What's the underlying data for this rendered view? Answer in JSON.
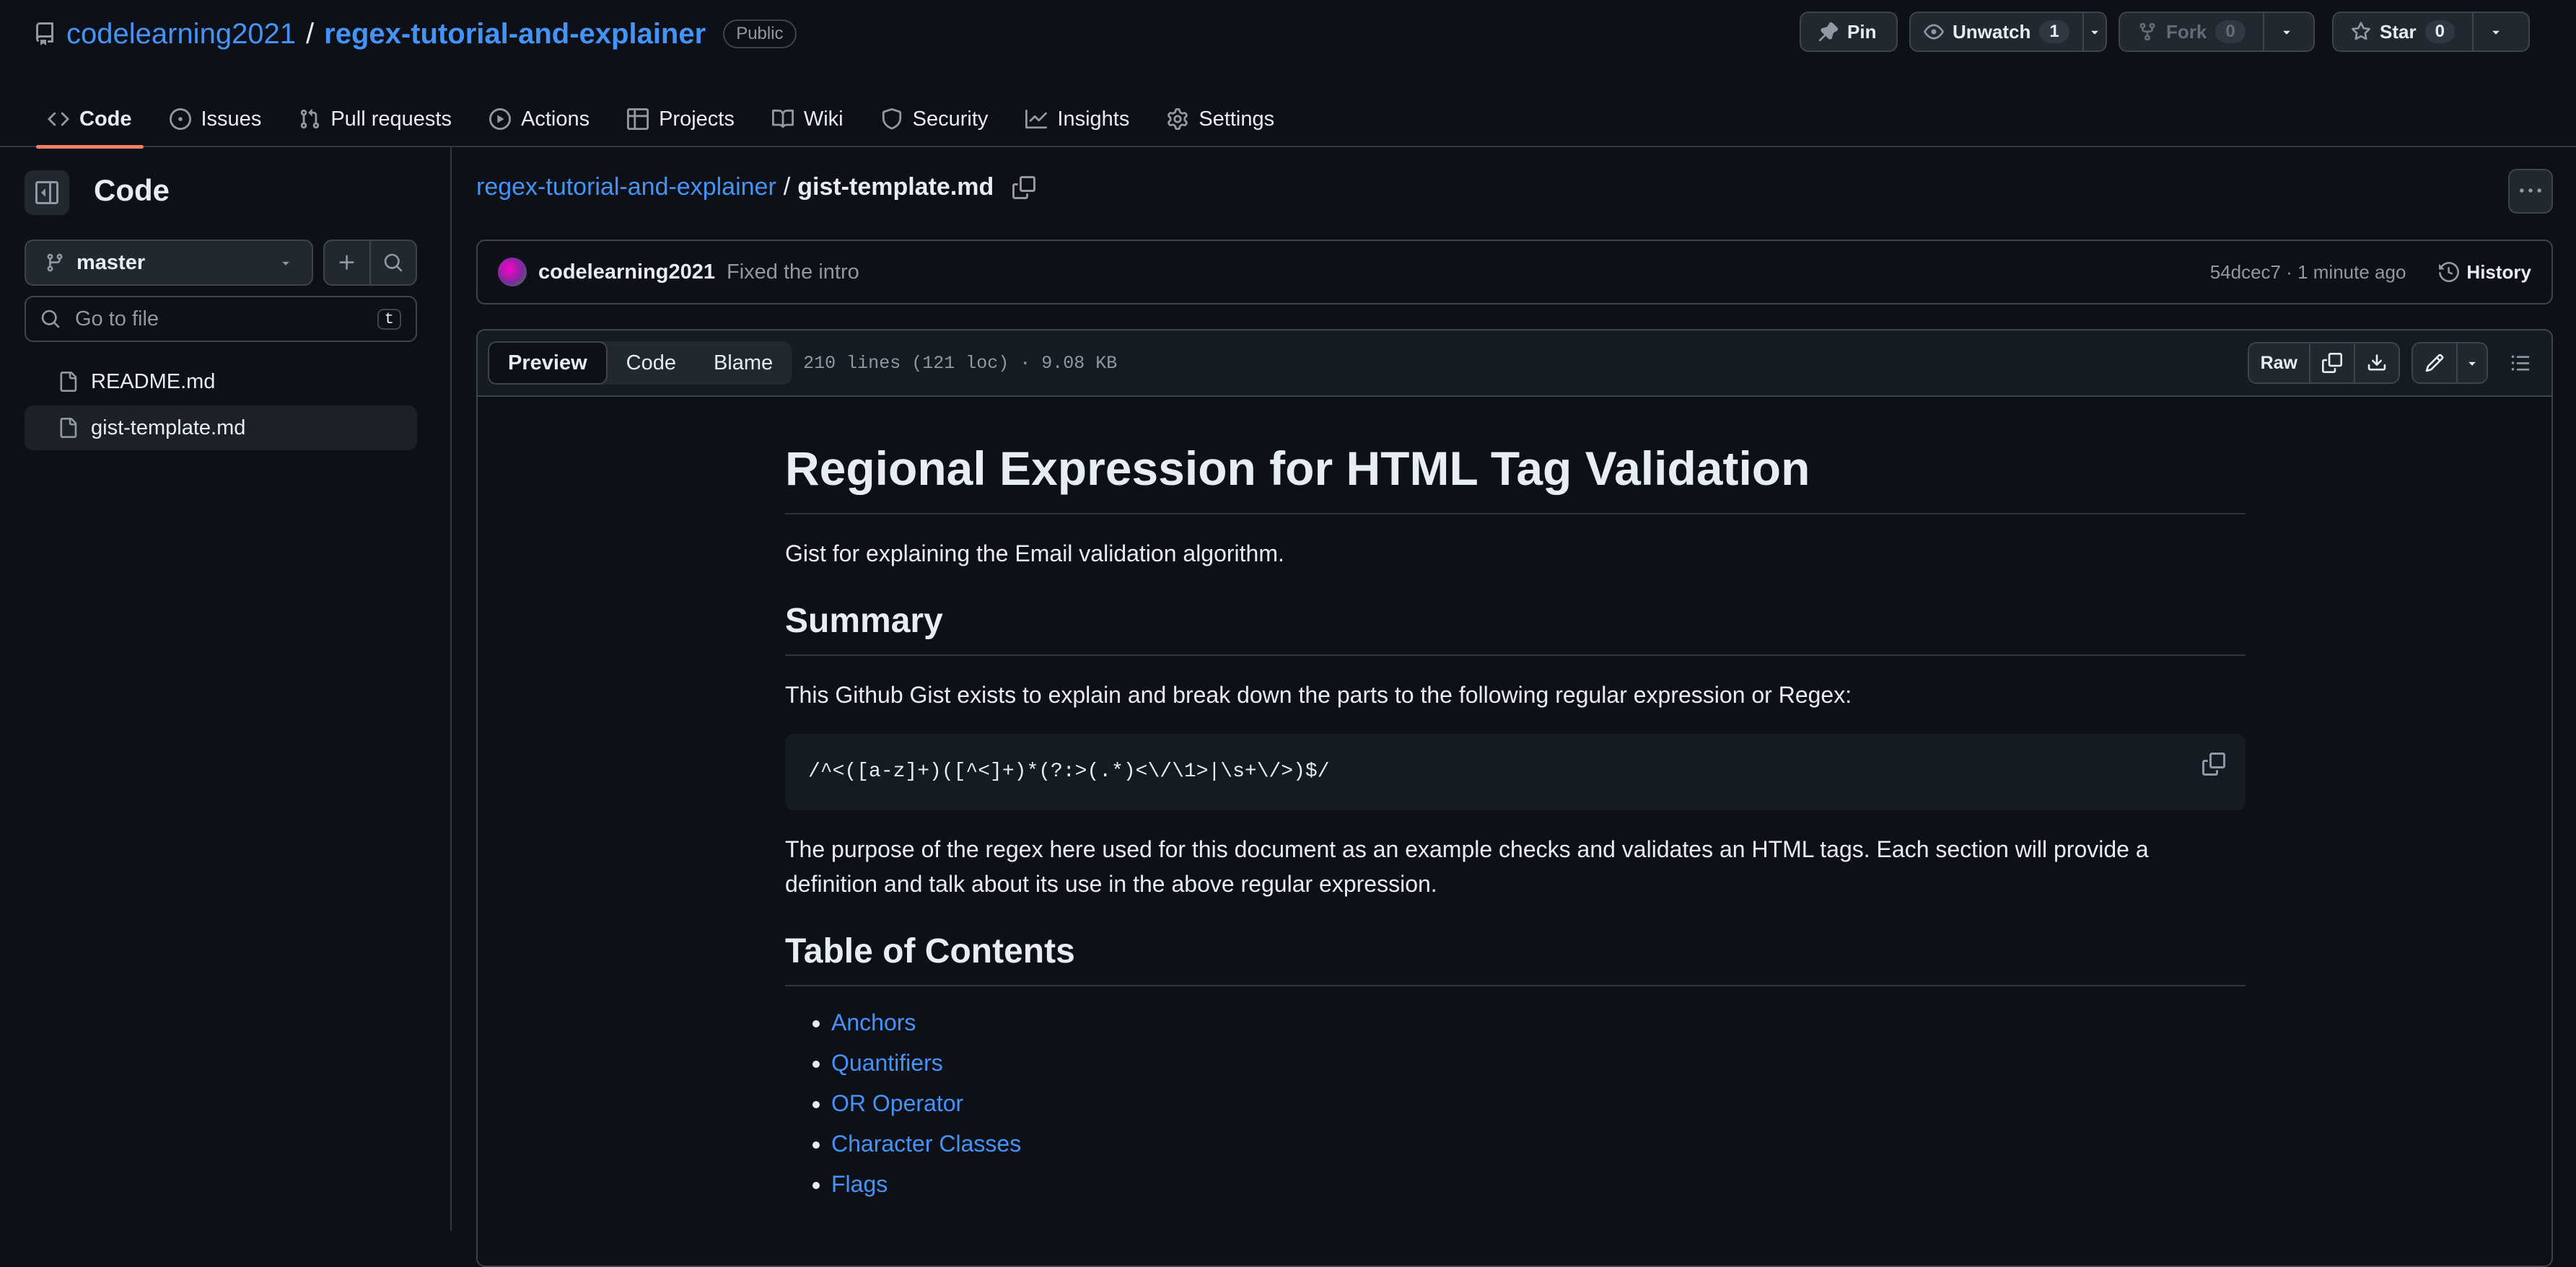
{
  "repo": {
    "owner": "codelearning2021",
    "separator": "/",
    "name": "regex-tutorial-and-explainer",
    "visibility": "Public"
  },
  "actions": {
    "pin": "Pin",
    "unwatch": "Unwatch",
    "watch_count": "1",
    "fork": "Fork",
    "fork_count": "0",
    "star": "Star",
    "star_count": "0"
  },
  "tabs": [
    {
      "label": "Code",
      "icon": "code-icon",
      "active": true
    },
    {
      "label": "Issues",
      "icon": "issue-icon"
    },
    {
      "label": "Pull requests",
      "icon": "pull-request-icon"
    },
    {
      "label": "Actions",
      "icon": "play-icon"
    },
    {
      "label": "Projects",
      "icon": "table-icon"
    },
    {
      "label": "Wiki",
      "icon": "book-icon"
    },
    {
      "label": "Security",
      "icon": "shield-icon"
    },
    {
      "label": "Insights",
      "icon": "graph-icon"
    },
    {
      "label": "Settings",
      "icon": "gear-icon"
    }
  ],
  "sidebar": {
    "title": "Code",
    "branch": "master",
    "go_to_file_placeholder": "Go to file",
    "shortcut": "t",
    "files": [
      {
        "name": "README.md",
        "selected": false
      },
      {
        "name": "gist-template.md",
        "selected": true
      }
    ]
  },
  "breadcrumb": {
    "repo": "regex-tutorial-and-explainer",
    "separator": "/",
    "file": "gist-template.md"
  },
  "commit": {
    "author": "codelearning2021",
    "message": "Fixed the intro",
    "meta": "54dcec7 · 1 minute ago",
    "history": "History"
  },
  "file_header": {
    "views": [
      "Preview",
      "Code",
      "Blame"
    ],
    "active_view": "Preview",
    "info": "210 lines (121 loc) · 9.08 KB",
    "raw": "Raw"
  },
  "doc": {
    "title": "Regional Expression for HTML Tag Validation",
    "intro": "Gist for explaining the Email validation algorithm.",
    "summary_heading": "Summary",
    "summary_text": "This Github Gist exists to explain and break down the parts to the following regular expression or Regex:",
    "regex": "/^<([a-z]+)([^<]+)*(?:>(.*)<\\/\\1>|\\s+\\/>)$/",
    "purpose_text": "The purpose of the regex here used for this document as an example checks and validates an HTML tags. Each section will provide a definition and talk about its use in the above regular expression.",
    "toc_heading": "Table of Contents",
    "toc": [
      "Anchors",
      "Quantifiers",
      "OR Operator",
      "Character Classes",
      "Flags"
    ]
  },
  "colors": {
    "background": "#0d1117",
    "link": "#4493f8",
    "active_tab_underline": "#f78166",
    "border": "#3d444d"
  }
}
